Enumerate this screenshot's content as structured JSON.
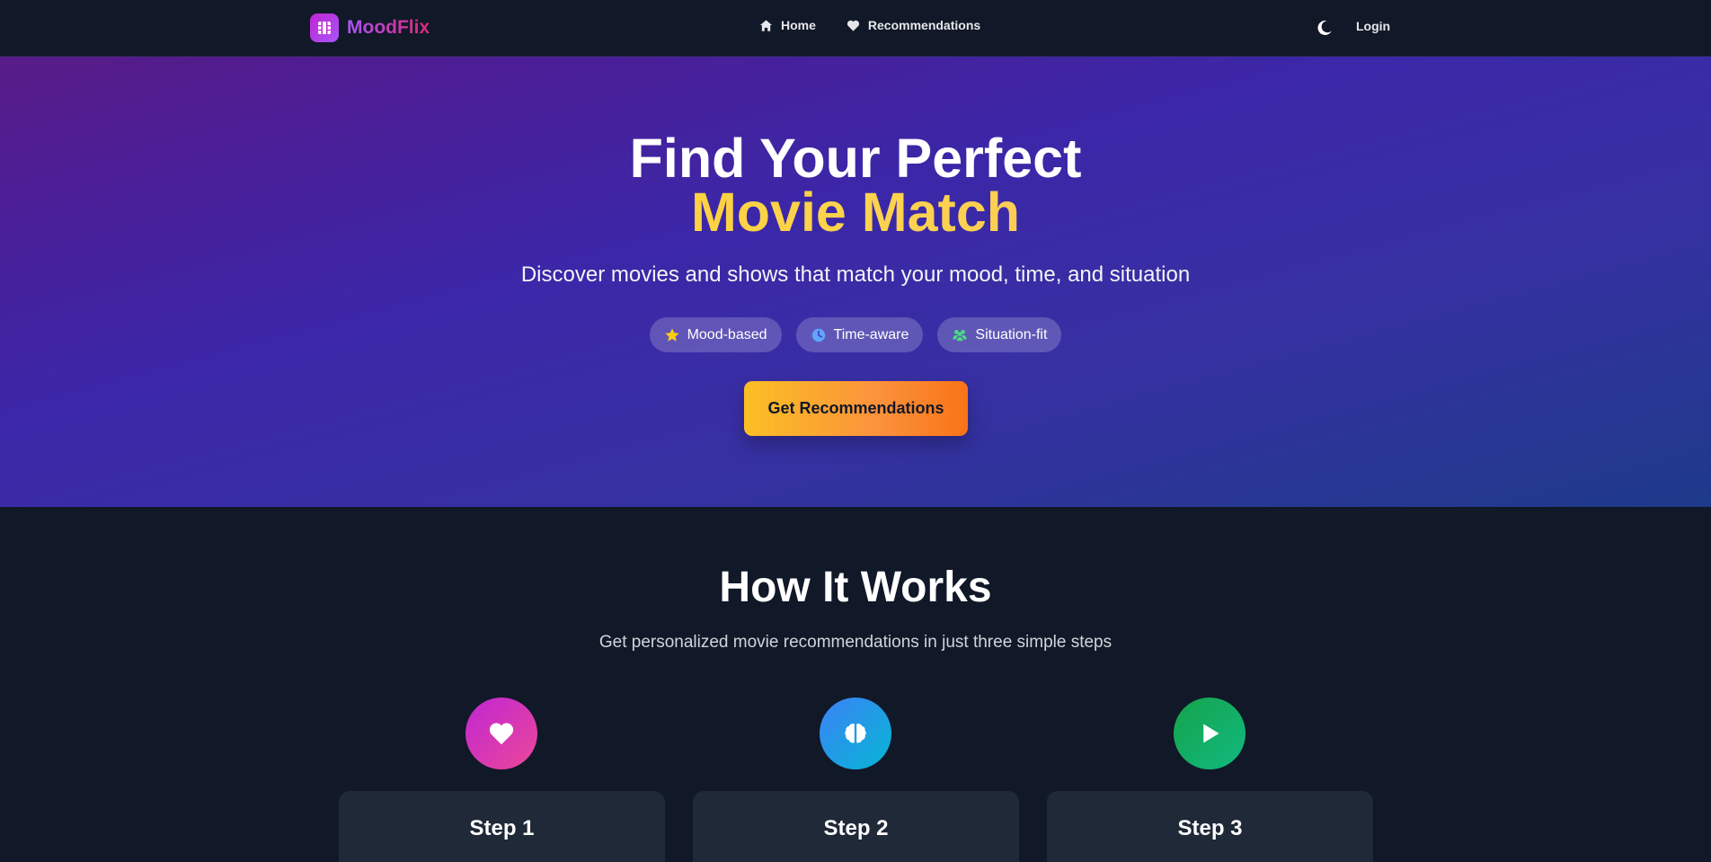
{
  "nav": {
    "brand": "MoodFlix",
    "links": [
      {
        "label": "Home",
        "icon": "home-icon"
      },
      {
        "label": "Recommendations",
        "icon": "heart-icon"
      }
    ],
    "theme_icon": "moon-icon",
    "login": "Login"
  },
  "hero": {
    "title_line1": "Find Your Perfect",
    "title_line2": "Movie Match",
    "subtitle": "Discover movies and shows that match your mood, time, and situation",
    "pills": [
      {
        "label": "Mood-based",
        "icon": "star-icon",
        "color": "#facc15"
      },
      {
        "label": "Time-aware",
        "icon": "clock-icon",
        "color": "#60a5fa"
      },
      {
        "label": "Situation-fit",
        "icon": "users-icon",
        "color": "#4ade80"
      }
    ],
    "cta": "Get Recommendations"
  },
  "how": {
    "title": "How It Works",
    "subtitle": "Get personalized movie recommendations in just three simple steps",
    "steps": [
      {
        "title": "Step 1",
        "icon": "heart-icon",
        "description": ""
      },
      {
        "title": "Step 2",
        "icon": "brain-icon",
        "description": ""
      },
      {
        "title": "Step 3",
        "icon": "play-icon",
        "description": ""
      }
    ]
  },
  "colors": {
    "background": "#111827",
    "card": "#1f2937",
    "accent_yellow": "#fbbf24",
    "accent_orange": "#f97316",
    "brand_gradient_start": "#a855f7",
    "brand_gradient_end": "#db2777"
  }
}
